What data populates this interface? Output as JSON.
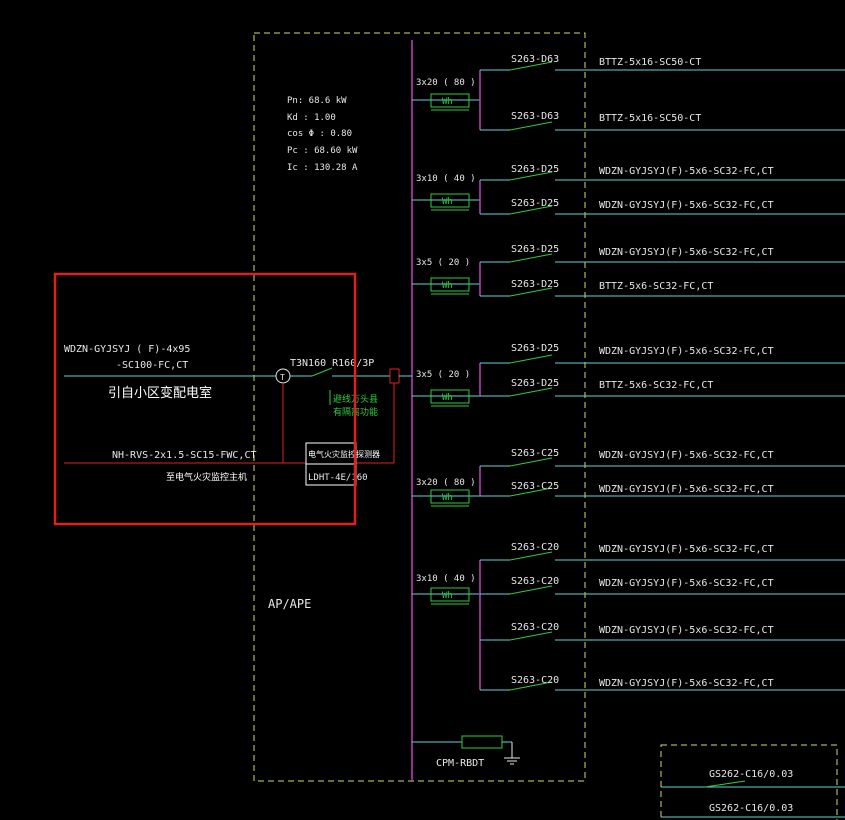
{
  "panel": {
    "label": "AP/APE",
    "params": [
      "Pn:  68.6   kW",
      "Kd  :  1.00",
      "cos  Φ  :  0.80",
      "Pc  :  68.60    kW",
      "Ic  :  130.28    A"
    ]
  },
  "incoming": {
    "cable_line1": "WDZN-GYJSYJ    ( F)-4x95",
    "cable_line2": "-SC100-FC,CT",
    "source": "引自小区变配电室",
    "breaker": "T3N160  R160/3P",
    "breaker_note1": "避线万头县",
    "breaker_note2": "有隔离功能",
    "monitor_cable": "NH-RVS-2x1.5-SC15-FWC,CT",
    "monitor_dest": "至电气火灾监控主机",
    "monitor_device_line1": "电气火灾监控探测器",
    "monitor_device_line2": "LDHT-4E/160"
  },
  "meter_label": "Wh",
  "meters": [
    {
      "rating": "3x20  ( 80 )"
    },
    {
      "rating": "3x10  ( 40 )"
    },
    {
      "rating": "3x5   ( 20 )"
    },
    {
      "rating": "3x5   ( 20 )"
    },
    {
      "rating": "3x20  ( 80 )"
    },
    {
      "rating": "3x10  ( 40 )"
    }
  ],
  "circuits": [
    {
      "breaker": "S263-D63",
      "cable": "BTTZ-5x16-SC50-CT"
    },
    {
      "breaker": "S263-D63",
      "cable": "BTTZ-5x16-SC50-CT"
    },
    {
      "breaker": "S263-D25",
      "cable": "WDZN-GYJSYJ(F)-5x6-SC32-FC,CT"
    },
    {
      "breaker": "S263-D25",
      "cable": "WDZN-GYJSYJ(F)-5x6-SC32-FC,CT"
    },
    {
      "breaker": "S263-D25",
      "cable": "WDZN-GYJSYJ(F)-5x6-SC32-FC,CT"
    },
    {
      "breaker": "S263-D25",
      "cable": "BTTZ-5x6-SC32-FC,CT"
    },
    {
      "breaker": "S263-D25",
      "cable": "WDZN-GYJSYJ(F)-5x6-SC32-FC,CT"
    },
    {
      "breaker": "S263-D25",
      "cable": "BTTZ-5x6-SC32-FC,CT"
    },
    {
      "breaker": "S263-C25",
      "cable": "WDZN-GYJSYJ(F)-5x6-SC32-FC,CT"
    },
    {
      "breaker": "S263-C25",
      "cable": "WDZN-GYJSYJ(F)-5x6-SC32-FC,CT"
    },
    {
      "breaker": "S263-C20",
      "cable": "WDZN-GYJSYJ(F)-5x6-SC32-FC,CT"
    },
    {
      "breaker": "S263-C20",
      "cable": "WDZN-GYJSYJ(F)-5x6-SC32-FC,CT"
    },
    {
      "breaker": "S263-C20",
      "cable": "WDZN-GYJSYJ(F)-5x6-SC32-FC,CT"
    },
    {
      "breaker": "S263-C20",
      "cable": "WDZN-GYJSYJ(F)-5x6-SC32-FC,CT"
    }
  ],
  "spd_label": "CPM-RBDT",
  "sub_panel": {
    "breakers": [
      "GS262-C16/0.03",
      "GS262-C16/0.03"
    ]
  },
  "colors": {
    "cable": "#5fd3d6",
    "busbar": "#c040c0",
    "device": "#2ecc40",
    "panel_border": "#d8d86a",
    "highlight": "#e02020"
  }
}
